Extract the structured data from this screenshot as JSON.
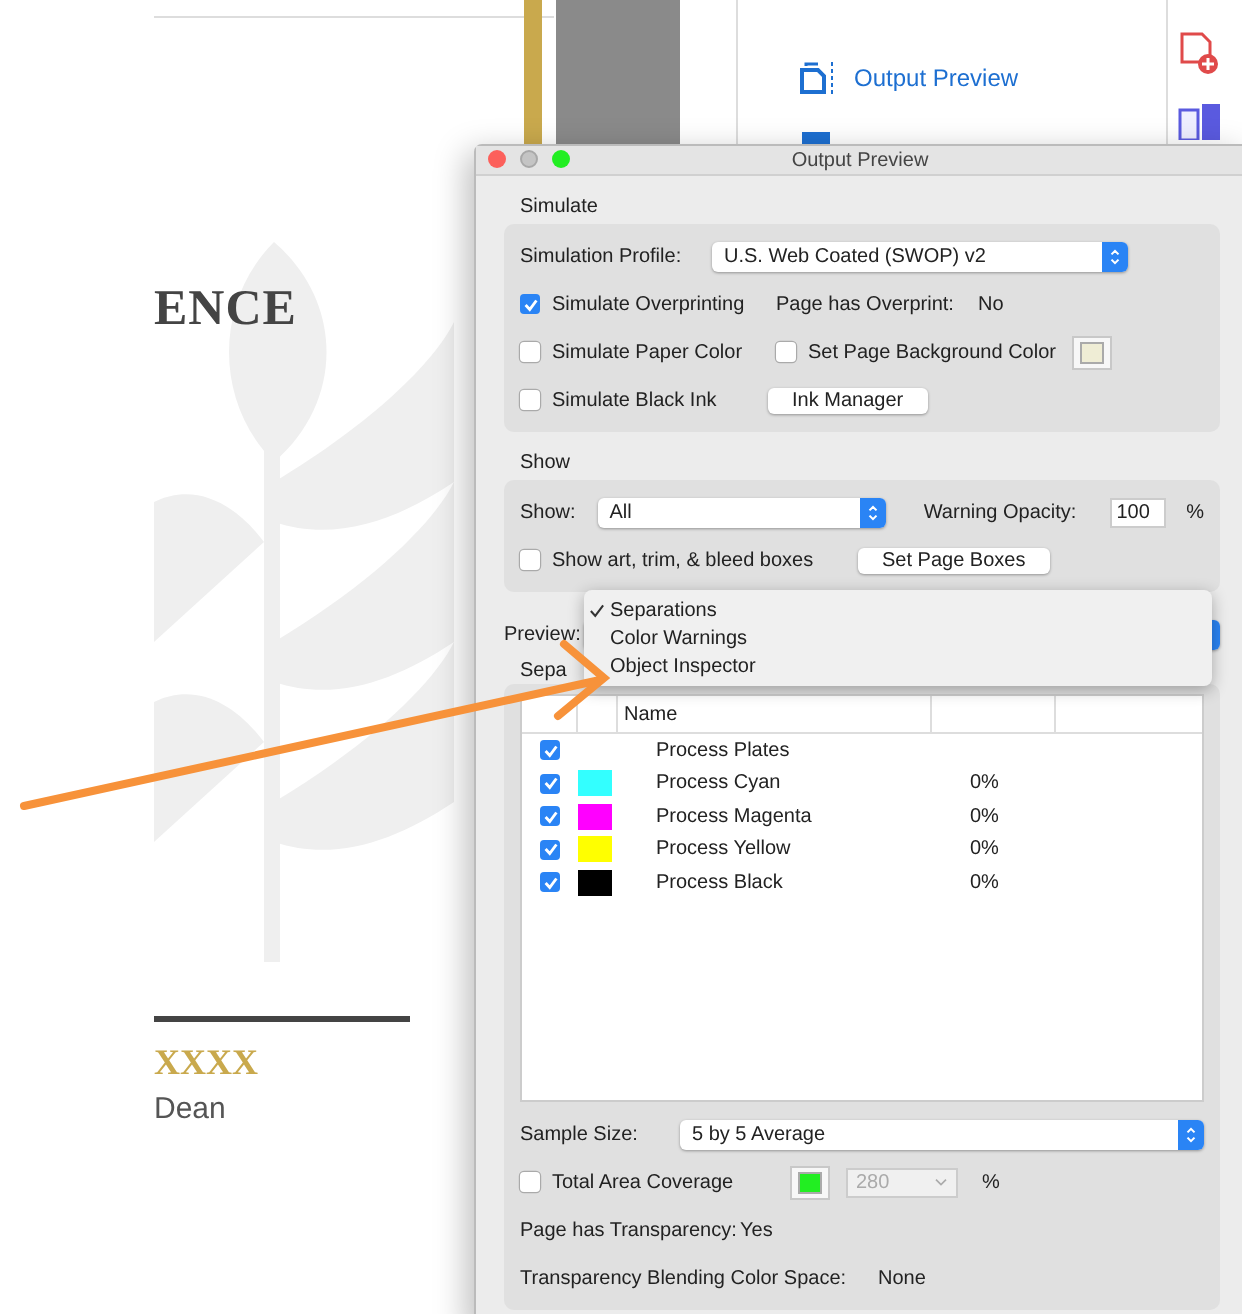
{
  "document": {
    "heading": "ENCE",
    "name_line": "XXXX",
    "subtitle": "Dean"
  },
  "tools_panel": {
    "items": [
      {
        "label": "Output Preview"
      }
    ]
  },
  "dialog": {
    "title": "Output Preview",
    "simulate": {
      "heading": "Simulate",
      "profile_label": "Simulation Profile:",
      "profile_value": "U.S. Web Coated (SWOP) v2",
      "overprinting": {
        "label": "Simulate Overprinting",
        "checked": true
      },
      "overprint_label": "Page has Overprint:",
      "overprint_value": "No",
      "paper_color": {
        "label": "Simulate Paper Color",
        "checked": false
      },
      "page_background": {
        "label": "Set Page Background Color",
        "checked": false
      },
      "black_ink": {
        "label": "Simulate Black Ink",
        "checked": false
      },
      "ink_manager_button": "Ink Manager"
    },
    "show": {
      "heading": "Show",
      "show_label": "Show:",
      "show_value": "All",
      "opacity_label": "Warning Opacity:",
      "opacity_value": "100",
      "opacity_unit": "%",
      "boxes": {
        "label": "Show art, trim, & bleed boxes",
        "checked": false
      },
      "page_boxes_button": "Set Page Boxes"
    },
    "preview": {
      "label": "Preview:",
      "menu": [
        {
          "label": "Separations",
          "selected": true
        },
        {
          "label": "Color Warnings",
          "selected": false
        },
        {
          "label": "Object Inspector",
          "selected": false
        }
      ]
    },
    "separations_label": "Sepa",
    "separations_table": {
      "columns": [
        "Name"
      ],
      "rows": [
        {
          "name": "Process Plates",
          "checked": true
        },
        {
          "name": "Process Cyan",
          "checked": true,
          "color": "#33ffff",
          "coverage": "0%"
        },
        {
          "name": "Process Magenta",
          "checked": true,
          "color": "#ff00ff",
          "coverage": "0%"
        },
        {
          "name": "Process Yellow",
          "checked": true,
          "color": "#ffff00",
          "coverage": "0%"
        },
        {
          "name": "Process Black",
          "checked": true,
          "color": "#000000",
          "coverage": "0%"
        }
      ]
    },
    "sample_size": {
      "label": "Sample Size:",
      "value": "5 by 5 Average"
    },
    "total_area": {
      "label": "Total Area Coverage",
      "checked": false,
      "value": "280",
      "disabled": true,
      "unit": "%"
    },
    "transparency": {
      "label": "Page has Transparency:",
      "value": "Yes"
    },
    "blending": {
      "label": "Transparency Blending Color Space:",
      "value": "None"
    }
  }
}
